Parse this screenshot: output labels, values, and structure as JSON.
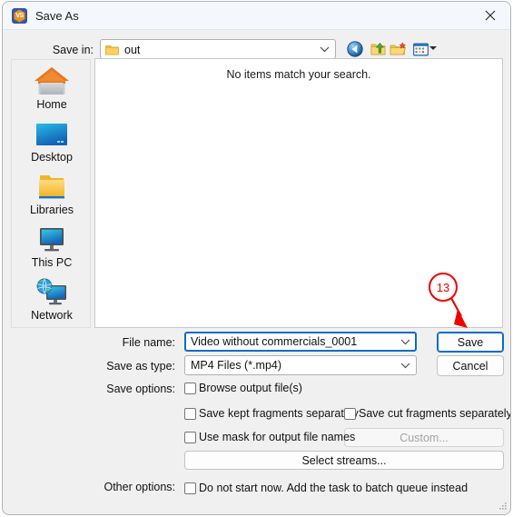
{
  "window": {
    "title": "Save As",
    "app_icon": "vs-app-icon",
    "app_icon_text": "VS",
    "close_label": "Close"
  },
  "toolbar": {
    "savein_label": "Save in:",
    "savein_value": "out",
    "savein_icon": "folder-icon",
    "buttons": [
      {
        "name": "back-button",
        "icon": "back-arrow-icon",
        "tooltip": "Back"
      },
      {
        "name": "up-one-level-button",
        "icon": "up-folder-icon",
        "tooltip": "Up One Level"
      },
      {
        "name": "new-folder-button",
        "icon": "new-folder-icon",
        "tooltip": "Create New Folder"
      },
      {
        "name": "views-button",
        "icon": "views-icon",
        "tooltip": "Views"
      }
    ]
  },
  "places": {
    "items": [
      {
        "label": "Home",
        "icon": "home-icon"
      },
      {
        "label": "Desktop",
        "icon": "desktop-icon"
      },
      {
        "label": "Libraries",
        "icon": "libraries-folder-icon"
      },
      {
        "label": "This PC",
        "icon": "this-pc-monitor-icon"
      },
      {
        "label": "Network",
        "icon": "network-globe-icon"
      }
    ]
  },
  "filelist": {
    "empty_message": "No items match your search."
  },
  "form": {
    "filename_label": "File name:",
    "filename_value": "Video without commercials_0001",
    "savetype_label": "Save as type:",
    "savetype_value": "MP4 Files (*.mp4)",
    "saveoptions_label": "Save options:",
    "otheroptions_label": "Other options:",
    "save_button": "Save",
    "cancel_button": "Cancel",
    "custom_button": "Custom...",
    "select_streams_button": "Select streams...",
    "checkboxes": {
      "browse_output": "Browse output file(s)",
      "save_kept": "Save kept fragments separately",
      "save_cut": "Save cut fragments separately",
      "use_mask": "Use mask for output file names",
      "do_not_start": "Do not start now. Add the task to batch queue instead"
    }
  },
  "annotation": {
    "step_number": "13",
    "color": "#ee0000",
    "points_to": "Save"
  }
}
